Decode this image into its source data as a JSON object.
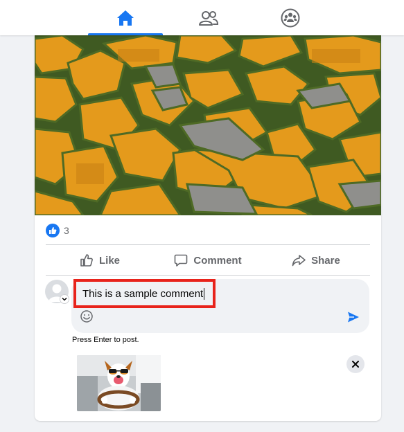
{
  "nav": {
    "tabs": [
      {
        "name": "home",
        "icon": "home-icon",
        "active": true
      },
      {
        "name": "friends",
        "icon": "friends-icon",
        "active": false
      },
      {
        "name": "groups",
        "icon": "groups-icon",
        "active": false
      }
    ],
    "accent_color": "#1877f2"
  },
  "post": {
    "image_description_icon": "photo",
    "reactions": {
      "icon": "like-reaction-icon",
      "count": "3"
    },
    "actions": {
      "like_label": "Like",
      "comment_label": "Comment",
      "share_label": "Share"
    }
  },
  "composer": {
    "value": "This is a sample comment",
    "hint": "Press Enter to post.",
    "highlight_color": "#e8231b"
  }
}
